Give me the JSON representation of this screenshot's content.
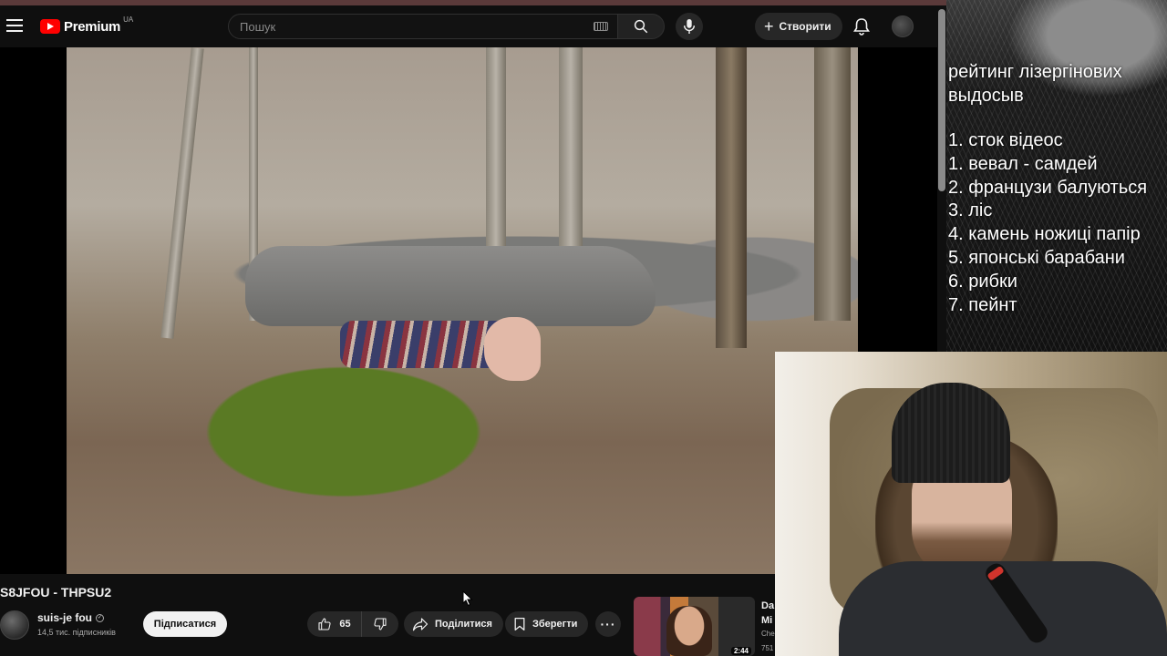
{
  "masthead": {
    "logo_text": "Premium",
    "logo_country": "UA",
    "search_placeholder": "Пошук",
    "create_label": "Створити"
  },
  "overlay": {
    "title": "рейтинг лізергінових\nвыдосыв",
    "items": [
      "1. сток відеос",
      "1. вевал - самдей",
      "2. французи балуються",
      "3. ліс",
      "4. камень ножиці папір",
      "5. японські барабани",
      "6. рибки",
      "7. пейнт"
    ]
  },
  "video": {
    "title": "S8JFOU - THPSU2",
    "channel_name": "suis-je fou",
    "subscribers": "14,5 тис. підписників",
    "subscribe_label": "Підписатися",
    "likes": "65",
    "share_label": "Поділитися",
    "save_label": "Зберегти"
  },
  "recommendation": {
    "duration": "2:44",
    "title": "Da\nMi",
    "meta": "Che\n751"
  },
  "colors": {
    "background": "#0f0f0f",
    "brand_red": "#ff0000",
    "subscribe_bg": "#f1f1f1",
    "pill_bg": "#272727"
  },
  "icons": {
    "menu": "hamburger-icon",
    "search": "search-icon",
    "mic": "mic-icon",
    "keyboard": "keyboard-icon",
    "bell": "bell-icon",
    "like": "thumbs-up-icon",
    "dislike": "thumbs-down-icon",
    "share": "share-icon",
    "save": "bookmark-icon",
    "more": "more-horizontal-icon"
  }
}
